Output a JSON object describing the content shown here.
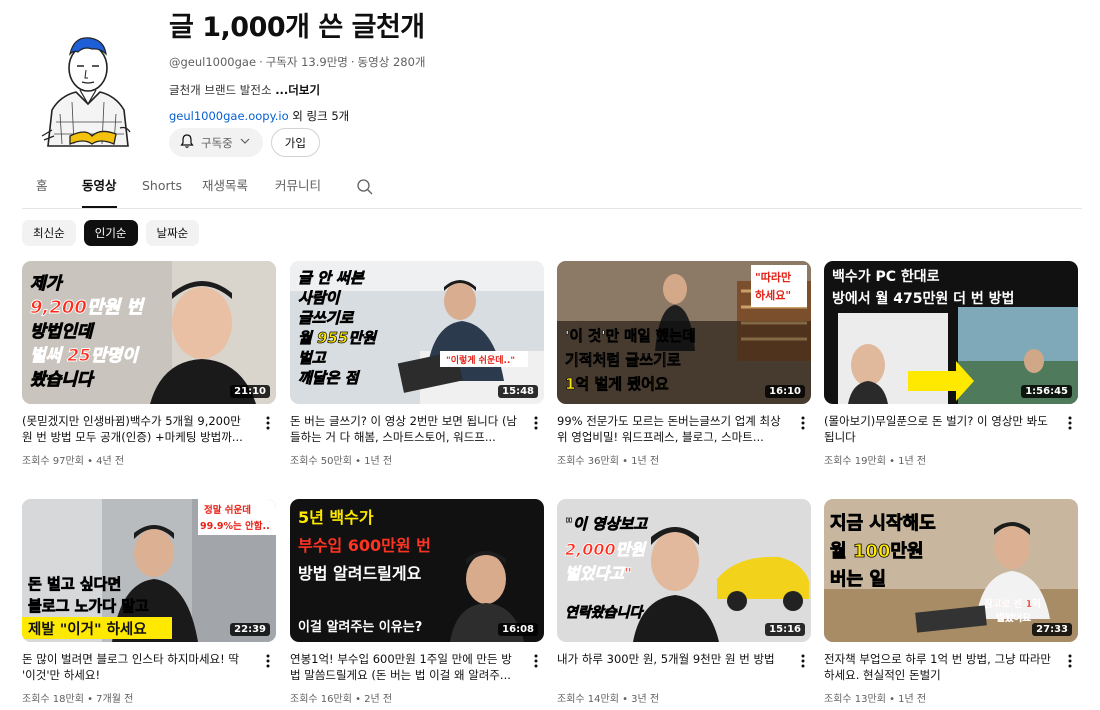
{
  "channel": {
    "name": "글 1,000개 쓴 글천개",
    "handle": "@geul1000gae",
    "subscribers": "구독자 13.9만명",
    "video_count": "동영상 280개",
    "description": "글천개 브랜드 발전소 ",
    "more_label": "...더보기",
    "link_url": "geul1000gae.oopy.io",
    "link_suffix": " 외 링크 5개",
    "subscribe_label": "구독중",
    "join_label": "가입"
  },
  "tabs": [
    "홈",
    "동영상",
    "Shorts",
    "재생목록",
    "커뮤니티"
  ],
  "active_tab": "동영상",
  "chips": [
    "최신순",
    "인기순",
    "날짜순"
  ],
  "active_chip": "인기순",
  "videos": [
    {
      "title": "(못믿겠지만 인생바뀜)백수가 5개월 9,200만원 번 방법 모두 공개(인증) +마케팅 방법까...",
      "stats": "조회수 97만회 • 4년 전",
      "duration": "21:10",
      "thumb_lines": [
        "제가",
        "9,200만원 번",
        "방법인데",
        "벌써 25만명이",
        "봤습니다"
      ]
    },
    {
      "title": "돈 버는 글쓰기? 이 영상 2번만 보면 됩니다 (남들하는 거 다 해봄, 스마트스토어, 워드프...",
      "stats": "조회수 50만회 • 1년 전",
      "duration": "15:48",
      "thumb_lines": [
        "글 안 써본",
        "사람이",
        "글쓰기로",
        "월 955만원",
        "벌고",
        "깨달은 점",
        "\"이렇게 쉬운데..\""
      ]
    },
    {
      "title": "99% 전문가도 모르는 돈버는글쓰기 업계 최상위 영업비밀! 워드프레스, 블로그, 스마트...",
      "stats": "조회수 36만회 • 1년 전",
      "duration": "16:10",
      "thumb_lines": [
        "\"따라만",
        "하세요\"",
        "'이 것'만 매일 했는데",
        "기적처럼 글쓰기로",
        "1억 벌게 됐어요"
      ]
    },
    {
      "title": "(몰아보기)무일푼으로 돈 벌기? 이 영상만 봐도 됩니다",
      "stats": "조회수 19만회 • 1년 전",
      "duration": "1:56:45",
      "thumb_lines": [
        "백수가 PC 한대로",
        "방에서 월 475만원 더 번 방법"
      ]
    },
    {
      "title": "돈 많이 벌려면 블로그 인스타 하지마세요! 딱 '이것'만 하세요!",
      "stats": "조회수 18만회 • 7개월 전",
      "duration": "22:39",
      "thumb_lines": [
        "정말 쉬운데",
        "99.9%는 안함..",
        "돈 벌고 싶다면",
        "블로그 노가다 말고",
        "제발 \"이거\" 하세요"
      ]
    },
    {
      "title": "연봉1억! 부수입 600만원 1주일 만에 만든 방법 말씀드릴게요 (돈 버는 법 이걸 왜 알려주...",
      "stats": "조회수 16만회 • 2년 전",
      "duration": "16:08",
      "thumb_lines": [
        "5년 백수가",
        "부수입 600만원 번",
        "방법 알려드릴게요",
        "이걸 알려주는 이유는?"
      ]
    },
    {
      "title": "내가 하루 300만 원, 5개월 9천만 원 번 방법",
      "stats": "조회수 14만회 • 3년 전",
      "duration": "15:16",
      "thumb_lines": [
        "\"이 영상보고",
        "2,000만원",
        "벌었다고\"",
        "연락왔습니다"
      ]
    },
    {
      "title": "전자책 부업으로 하루 1억 번 방법, 그냥 따라만 하세요. 현실적인 돈벌기",
      "stats": "조회수 13만회 • 1년 전",
      "duration": "27:33",
      "thumb_lines": [
        "지금 시작해도",
        "월 100만원",
        "버는 일",
        "참고로 전 1억",
        "벌었어요"
      ]
    }
  ],
  "colors": {
    "accent_red": "#e62117",
    "highlight_yellow": "#ffe900",
    "link_blue": "#065fd4"
  }
}
